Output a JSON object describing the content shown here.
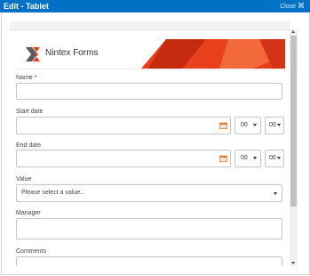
{
  "window": {
    "title": "Edit - Tablet",
    "close_label": "Close",
    "close_glyph": "⌘",
    "accent": "#0072c6"
  },
  "banner": {
    "logo_text": "Nintex Forms",
    "logo_icon": "nintex-x-logo",
    "colors": [
      "#e8401c",
      "#c42a0f",
      "#f26a3c"
    ]
  },
  "form": {
    "name": {
      "label": "Name",
      "required_marker": "*",
      "value": ""
    },
    "start_date": {
      "label": "Start date",
      "hour": "00",
      "minute": "00",
      "calendar_icon": "calendar-icon"
    },
    "end_date": {
      "label": "End date",
      "hour": "00",
      "minute": "00",
      "calendar_icon": "calendar-icon"
    },
    "value": {
      "label": "Value",
      "placeholder": "Please select a value..."
    },
    "manager": {
      "label": "Manager",
      "value": ""
    },
    "comments": {
      "label": "Comments",
      "value": ""
    }
  }
}
